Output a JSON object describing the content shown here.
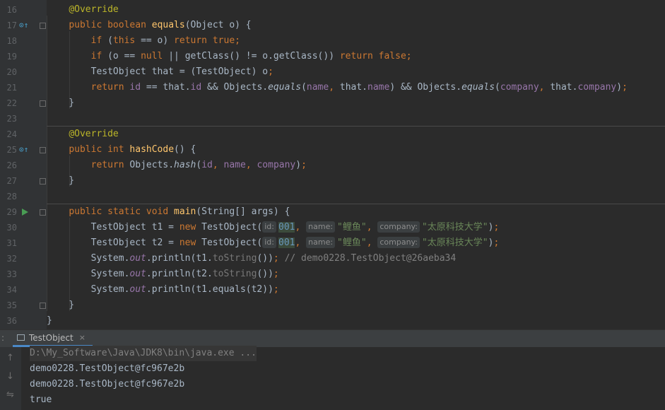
{
  "editor": {
    "lines": [
      {
        "n": "16",
        "code": [
          {
            "t": "    "
          },
          {
            "t": "@Override",
            "c": "an"
          }
        ]
      },
      {
        "n": "17",
        "icons": "override",
        "fold": true,
        "code": [
          {
            "t": "    "
          },
          {
            "t": "public ",
            "c": "kw"
          },
          {
            "t": "boolean ",
            "c": "kw"
          },
          {
            "t": "equals",
            "c": "fn"
          },
          {
            "t": "(Object o) {"
          }
        ]
      },
      {
        "n": "18",
        "code": [
          {
            "t": "        "
          },
          {
            "t": "if ",
            "c": "kw"
          },
          {
            "t": "("
          },
          {
            "t": "this ",
            "c": "kw"
          },
          {
            "t": "== o) "
          },
          {
            "t": "return ",
            "c": "kw"
          },
          {
            "t": "true",
            "c": "kw"
          },
          {
            "t": ";",
            "c": "kw"
          }
        ]
      },
      {
        "n": "19",
        "code": [
          {
            "t": "        "
          },
          {
            "t": "if ",
            "c": "kw"
          },
          {
            "t": "(o == "
          },
          {
            "t": "null ",
            "c": "kw"
          },
          {
            "t": "|| getClass() != o.getClass()) "
          },
          {
            "t": "return ",
            "c": "kw"
          },
          {
            "t": "false",
            "c": "kw"
          },
          {
            "t": ";",
            "c": "kw"
          }
        ]
      },
      {
        "n": "20",
        "code": [
          {
            "t": "        TestObject that = (TestObject) o"
          },
          {
            "t": ";",
            "c": "kw"
          }
        ]
      },
      {
        "n": "21",
        "code": [
          {
            "t": "        "
          },
          {
            "t": "return ",
            "c": "kw"
          },
          {
            "t": "id",
            "c": "fl"
          },
          {
            "t": " == that."
          },
          {
            "t": "id",
            "c": "fl"
          },
          {
            "t": " && Objects."
          },
          {
            "t": "equals",
            "c": "it"
          },
          {
            "t": "("
          },
          {
            "t": "name",
            "c": "fl"
          },
          {
            "t": ", ",
            "c": "kw"
          },
          {
            "t": "that."
          },
          {
            "t": "name",
            "c": "fl"
          },
          {
            "t": ") && Objects."
          },
          {
            "t": "equals",
            "c": "it"
          },
          {
            "t": "("
          },
          {
            "t": "company",
            "c": "fl"
          },
          {
            "t": ", ",
            "c": "kw"
          },
          {
            "t": "that."
          },
          {
            "t": "company",
            "c": "fl"
          },
          {
            "t": ")"
          },
          {
            "t": ";",
            "c": "kw"
          }
        ]
      },
      {
        "n": "22",
        "fold": true,
        "code": [
          {
            "t": "    }"
          }
        ]
      },
      {
        "n": "23",
        "code": []
      },
      {
        "n": "24",
        "sep": true,
        "code": [
          {
            "t": "    "
          },
          {
            "t": "@Override",
            "c": "an"
          }
        ]
      },
      {
        "n": "25",
        "icons": "override",
        "fold": true,
        "code": [
          {
            "t": "    "
          },
          {
            "t": "public ",
            "c": "kw"
          },
          {
            "t": "int ",
            "c": "kw"
          },
          {
            "t": "hashCode",
            "c": "fn"
          },
          {
            "t": "() {"
          }
        ]
      },
      {
        "n": "26",
        "code": [
          {
            "t": "        "
          },
          {
            "t": "return ",
            "c": "kw"
          },
          {
            "t": "Objects."
          },
          {
            "t": "hash",
            "c": "it"
          },
          {
            "t": "("
          },
          {
            "t": "id",
            "c": "fl"
          },
          {
            "t": ", ",
            "c": "kw"
          },
          {
            "t": "name",
            "c": "fl"
          },
          {
            "t": ", ",
            "c": "kw"
          },
          {
            "t": "company",
            "c": "fl"
          },
          {
            "t": ")"
          },
          {
            "t": ";",
            "c": "kw"
          }
        ]
      },
      {
        "n": "27",
        "fold": true,
        "code": [
          {
            "t": "    }"
          }
        ]
      },
      {
        "n": "28",
        "code": []
      },
      {
        "n": "29",
        "sep": true,
        "icons": "run",
        "fold": true,
        "code": [
          {
            "t": "    "
          },
          {
            "t": "public ",
            "c": "kw"
          },
          {
            "t": "static ",
            "c": "kw"
          },
          {
            "t": "void ",
            "c": "kw"
          },
          {
            "t": "main",
            "c": "fn"
          },
          {
            "t": "(String[] args) {"
          }
        ]
      },
      {
        "n": "30",
        "code": [
          {
            "t": "        TestObject t1 = "
          },
          {
            "t": "new ",
            "c": "kw"
          },
          {
            "t": "TestObject("
          },
          {
            "t": "id:",
            "c": "hint"
          },
          {
            "t": "001",
            "c": "nm hl"
          },
          {
            "t": ", ",
            "c": "kw"
          },
          {
            "t": "name:",
            "c": "hint"
          },
          {
            "t": "\"鲤鱼\"",
            "c": "st"
          },
          {
            "t": ", ",
            "c": "kw"
          },
          {
            "t": "company:",
            "c": "hint"
          },
          {
            "t": "\"太原科技大学\"",
            "c": "st"
          },
          {
            "t": ")"
          },
          {
            "t": ";",
            "c": "kw"
          }
        ]
      },
      {
        "n": "31",
        "code": [
          {
            "t": "        TestObject t2 = "
          },
          {
            "t": "new ",
            "c": "kw"
          },
          {
            "t": "TestObject("
          },
          {
            "t": "id:",
            "c": "hint"
          },
          {
            "t": "001",
            "c": "nm hl"
          },
          {
            "t": ", ",
            "c": "kw"
          },
          {
            "t": "name:",
            "c": "hint"
          },
          {
            "t": "\"鲤鱼\"",
            "c": "st"
          },
          {
            "t": ", ",
            "c": "kw"
          },
          {
            "t": "company:",
            "c": "hint"
          },
          {
            "t": "\"太原科技大学\"",
            "c": "st"
          },
          {
            "t": ")"
          },
          {
            "t": ";",
            "c": "kw"
          }
        ]
      },
      {
        "n": "32",
        "code": [
          {
            "t": "        System."
          },
          {
            "t": "out",
            "c": "fl it"
          },
          {
            "t": ".println(t1."
          },
          {
            "t": "toString",
            "c": "gray"
          },
          {
            "t": "())"
          },
          {
            "t": "; ",
            "c": "kw"
          },
          {
            "t": "// demo0228.TestObject@26aeba34",
            "c": "cm"
          }
        ]
      },
      {
        "n": "33",
        "code": [
          {
            "t": "        System."
          },
          {
            "t": "out",
            "c": "fl it"
          },
          {
            "t": ".println(t2."
          },
          {
            "t": "toString",
            "c": "gray"
          },
          {
            "t": "())"
          },
          {
            "t": ";",
            "c": "kw"
          }
        ]
      },
      {
        "n": "34",
        "code": [
          {
            "t": "        System."
          },
          {
            "t": "out",
            "c": "fl it"
          },
          {
            "t": ".println(t1.equals(t2))"
          },
          {
            "t": ";",
            "c": "kw"
          }
        ]
      },
      {
        "n": "35",
        "fold": true,
        "code": [
          {
            "t": "    }"
          }
        ]
      },
      {
        "n": "36",
        "code": [
          {
            "t": "}"
          }
        ]
      }
    ]
  },
  "run_panel": {
    "colon": ":",
    "tab_label": "TestObject",
    "tab_close": "×",
    "command": "D:\\My_Software\\Java\\JDK8\\bin\\java.exe ...",
    "output": [
      "demo0228.TestObject@fc967e2b",
      "demo0228.TestObject@fc967e2b",
      "true"
    ],
    "tool_icons": [
      "arrow-up-icon",
      "arrow-down-icon",
      "soft-wrap-icon"
    ]
  },
  "colors": {
    "keyword": "#cc7832",
    "annotation": "#bbb529",
    "function": "#ffc66d",
    "string": "#6a8759",
    "number": "#6897bb",
    "field": "#9876aa",
    "comment": "#808080",
    "background": "#2b2b2b"
  }
}
